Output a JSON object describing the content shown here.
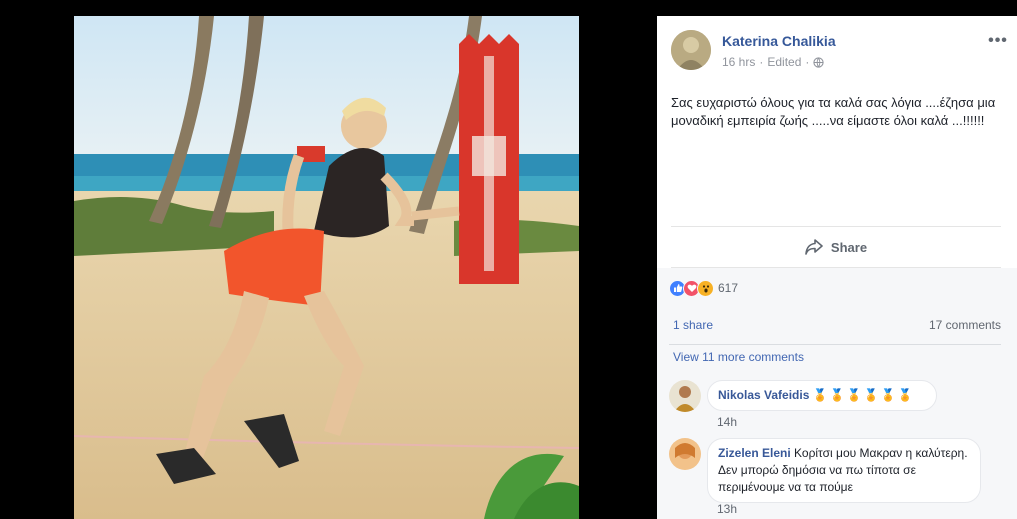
{
  "post": {
    "author": "Katerina Chalikia",
    "time": "16 hrs",
    "separator": "·",
    "edited": "Edited",
    "privacy_icon": "globe-icon",
    "options_icon": "more-options-icon",
    "options_glyph": "•••",
    "text": "Σας ευχαριστώ όλους για τα καλά σας λόγια ....έζησα μια μοναδική εμπειρία ζωής .....να είμαστε όλοι καλά ...!!!!!!"
  },
  "actions": {
    "share_label": "Share",
    "share_icon": "share-arrow-icon"
  },
  "reactions": {
    "types": [
      "like",
      "love",
      "wow"
    ],
    "count": "617"
  },
  "stats": {
    "shares": "1 share",
    "comments": "17 comments"
  },
  "comments_section": {
    "view_more": "View 11 more comments",
    "comments": [
      {
        "name": "Nikolas Vafeidis",
        "text": "🏅🏅🏅🏅🏅🏅",
        "time": "14h"
      },
      {
        "name": "Zizelen Eleni",
        "text": "Κορίτσι μου Μακραν η καλύτερη. Δεν μπορώ δημόσια να πω τίποτα σε περιμένουμε να τα πούμε",
        "time": "13h"
      }
    ]
  },
  "colors": {
    "link_blue": "#365899",
    "meta_gray": "#90949c",
    "like_blue": "#4080ff",
    "love_red": "#f25268",
    "wow_yellow": "#f7b125",
    "panel_bg": "#ffffff",
    "viewer_bg": "#000000"
  }
}
